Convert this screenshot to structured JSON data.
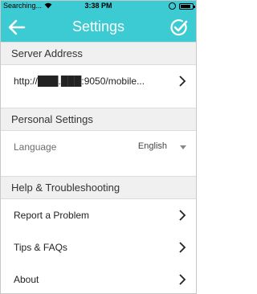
{
  "status_bar": {
    "carrier": "Searching...",
    "time": "3:38 PM"
  },
  "header": {
    "title": "Settings"
  },
  "sections": {
    "server": {
      "title": "Server Address",
      "url": "http://███.███:9050/mobile..."
    },
    "personal": {
      "title": "Personal Settings",
      "language_label": "Language",
      "language_value": "English"
    },
    "help": {
      "title": "Help & Troubleshooting",
      "items": [
        {
          "label": "Report a Problem"
        },
        {
          "label": "Tips & FAQs"
        },
        {
          "label": "About"
        }
      ]
    }
  },
  "icons": {
    "back": "arrow-left-icon",
    "done": "check-circle-icon",
    "chevron": "chevron-right-icon"
  },
  "colors": {
    "accent": "#3ccbd3",
    "section_bg": "#f0f0f0"
  }
}
